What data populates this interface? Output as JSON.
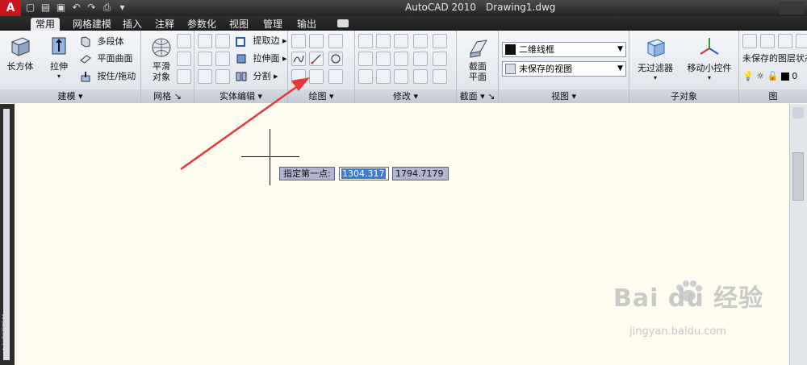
{
  "titlebar": {
    "app_name": "AutoCAD 2010",
    "file_name": "Drawing1.dwg",
    "app_button_glyph": "A"
  },
  "tabs": [
    {
      "label": "常用",
      "active": true
    },
    {
      "label": "网格建模"
    },
    {
      "label": "插入"
    },
    {
      "label": "注释"
    },
    {
      "label": "参数化"
    },
    {
      "label": "视图"
    },
    {
      "label": "管理"
    },
    {
      "label": "输出"
    }
  ],
  "ribbon": {
    "modeling": {
      "title": "建模",
      "box_label": "长方体",
      "extrude_label": "拉伸",
      "polysolid_label": "多段体",
      "planar_surface_label": "平面曲面",
      "presspull_label": "按住/拖动"
    },
    "mesh": {
      "title": "网格",
      "smooth_label": "平滑\n对象"
    },
    "solid_edit": {
      "title": "实体编辑",
      "extract_edges_label": "提取边",
      "extrude_faces_label": "拉伸面",
      "separate_label": "分割"
    },
    "draw": {
      "title": "绘图"
    },
    "modify": {
      "title": "修改"
    },
    "section": {
      "title": "截面",
      "section_plane_label": "截面\n平面"
    },
    "view": {
      "title": "视图",
      "visual_style_value": "二维线框",
      "saved_view_value": "未保存的视图"
    },
    "subobject": {
      "title": "子对象",
      "no_filter_label": "无过滤器",
      "move_gizmo_label": "移动小控件"
    },
    "layers": {
      "title": "图",
      "layer_state_value": "未保存的图层状态",
      "layer_value": "0"
    }
  },
  "canvas": {
    "prompt_label": "指定第一点:",
    "coord_x": "1304.317",
    "coord_y": "1794.7179",
    "left_palette_label": "工具选项板"
  },
  "watermark": {
    "text": "Bai du 经验",
    "url": "jingyan.baidu.com"
  },
  "colors": {
    "canvas_bg": "#fffdf0",
    "annotation_arrow": "#e8343a",
    "app_button": "#c8171c"
  }
}
